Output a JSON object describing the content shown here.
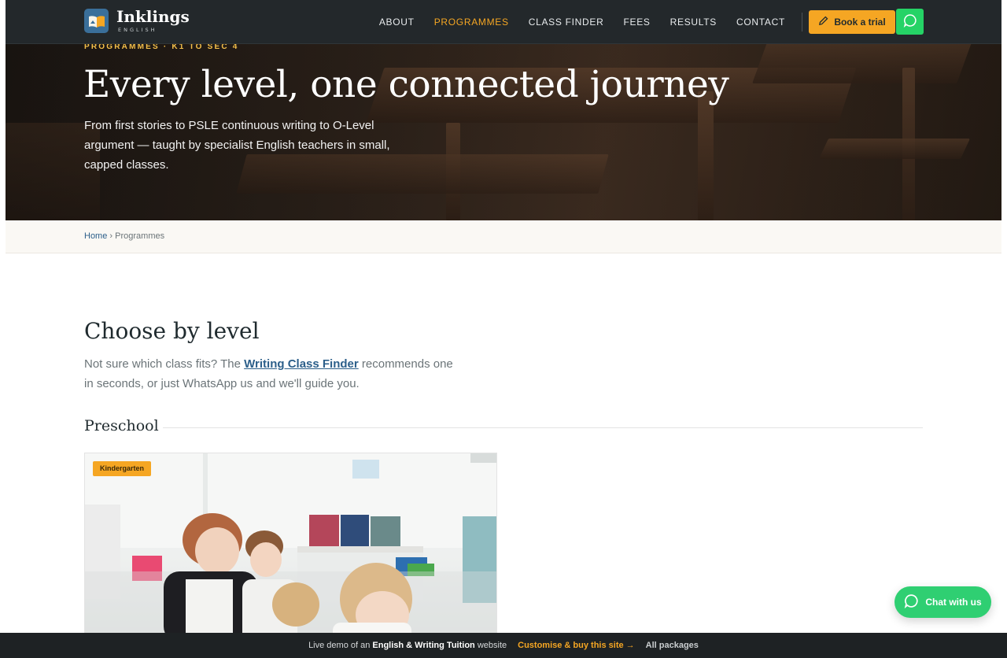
{
  "nav": {
    "brand": "Inklings",
    "brand_sub": "ENGLISH",
    "items": [
      {
        "label": "ABOUT",
        "active": false
      },
      {
        "label": "PROGRAMMES",
        "active": true
      },
      {
        "label": "CLASS FINDER",
        "active": false
      },
      {
        "label": "FEES",
        "active": false
      },
      {
        "label": "RESULTS",
        "active": false
      },
      {
        "label": "CONTACT",
        "active": false
      }
    ],
    "cta_label": "Book a trial",
    "whatsapp_icon": "whatsapp-icon",
    "accent_color": "#f5a623",
    "whatsapp_color": "#25d366"
  },
  "hero": {
    "eyebrow": "PROGRAMMES · K1 TO SEC 4",
    "title": "Every level, one connected journey",
    "lede": "From first stories to PSLE continuous writing to O-Level argument — taught by specialist English teachers in small, capped classes."
  },
  "breadcrumb": {
    "home": "Home",
    "sep": "›",
    "current": "Programmes"
  },
  "main": {
    "heading": "Choose by level",
    "intro_before": "Not sure which class fits? The ",
    "intro_link": "Writing Class Finder",
    "intro_after": " recommends one in seconds, or just WhatsApp us and we'll guide you.",
    "groups": [
      {
        "title": "Preschool",
        "cards": [
          {
            "badge": "Kindergarten"
          }
        ]
      }
    ]
  },
  "chat": {
    "label": "Chat with us",
    "icon": "chat-bubble-icon"
  },
  "demo_bar": {
    "text_before": "Live demo of an ",
    "text_bold": "English & Writing Tuition",
    "text_after": " website",
    "cta": "Customise & buy this site →",
    "packages": "All packages"
  }
}
